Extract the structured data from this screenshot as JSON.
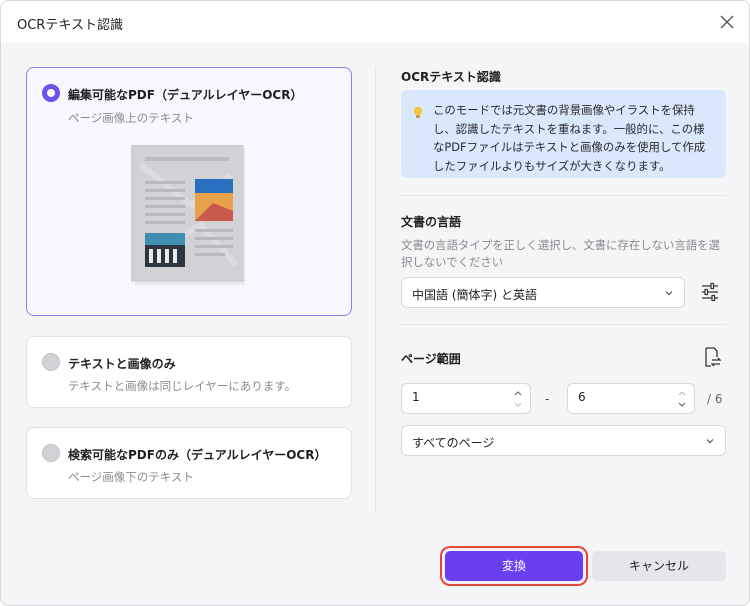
{
  "window": {
    "title": "OCRテキスト認識"
  },
  "options": [
    {
      "title": "編集可能なPDF（デュアルレイヤーOCR）",
      "subtitle": "ページ画像上のテキスト",
      "selected": true
    },
    {
      "title": "テキストと画像のみ",
      "subtitle": "テキストと画像は同じレイヤーにあります。",
      "selected": false
    },
    {
      "title": "検索可能なPDFのみ（デュアルレイヤーOCR）",
      "subtitle": "ページ画像下のテキスト",
      "selected": false
    }
  ],
  "ocr_section": {
    "heading": "OCRテキスト認識",
    "info": "このモードでは元文書の背景画像やイラストを保持し、認識したテキストを重ねます。一般的に、この様なPDFファイルはテキストと画像のみを使用して作成したファイルよりもサイズが大きくなります。"
  },
  "language_section": {
    "heading": "文書の言語",
    "description": "文書の言語タイプを正しく選択し、文書に存在しない言語を選択しないでください",
    "selected": "中国語 (簡体字) と英語"
  },
  "page_range": {
    "heading": "ページ範囲",
    "from": "1",
    "separator": "-",
    "to": "6",
    "total": "/ 6",
    "scope": "すべてのページ"
  },
  "buttons": {
    "convert": "変換",
    "cancel": "キャンセル"
  },
  "colors": {
    "accent": "#6a3ff2",
    "info_bg": "#d9e8fb",
    "highlight": "#e2483f"
  }
}
